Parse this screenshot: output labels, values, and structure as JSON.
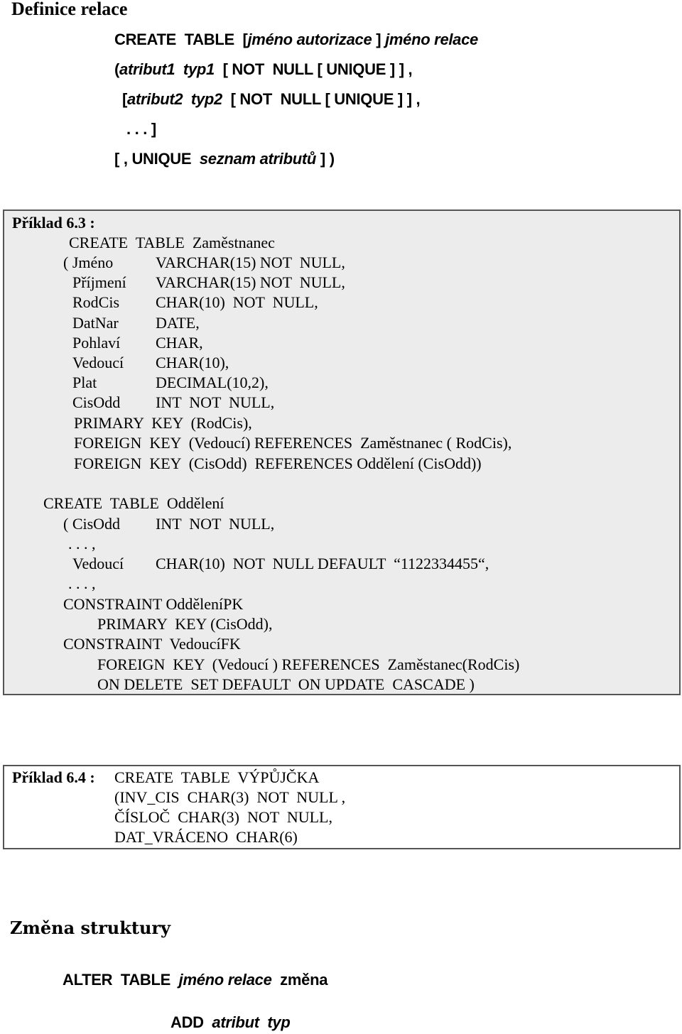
{
  "heading1": "Definice relace",
  "syntax": {
    "l1_kw": "CREATE  TABLE  [",
    "l1_it1": "jméno autorizace",
    "l1_mid": " ] ",
    "l1_it2": "jméno relace",
    "l2_a": "(",
    "l2_it": "atribut1  typ1",
    "l2_b": "  [ NOT  NULL [ UNIQUE ] ] ,",
    "l3_a": "[",
    "l3_it": "atribut2  typ2",
    "l3_b": "  [ NOT  NULL [ UNIQUE ] ] ,",
    "l4": ". . . ]",
    "l5_a": "[ , UNIQUE  ",
    "l5_it": "seznam atributů",
    "l5_b": " ] )"
  },
  "example63": {
    "label": "Příklad 6.3 :",
    "create1": "CREATE  TABLE  Zaměstnanec",
    "cols": [
      [
        "( Jméno",
        "VARCHAR(15) NOT  NULL,"
      ],
      [
        "Příjmení",
        "VARCHAR(15) NOT  NULL,"
      ],
      [
        "RodCis",
        "CHAR(10)  NOT  NULL,"
      ],
      [
        "DatNar",
        "DATE,"
      ],
      [
        "Pohlaví",
        "CHAR,"
      ],
      [
        "Vedoucí",
        "CHAR(10),"
      ],
      [
        "Plat",
        "DECIMAL(10,2),"
      ],
      [
        "CisOdd",
        "INT  NOT  NULL,"
      ]
    ],
    "pk": "PRIMARY  KEY  (RodCis),",
    "fk1": "FOREIGN  KEY  (Vedoucí) REFERENCES  Zaměstnanec ( RodCis),",
    "fk2": "FOREIGN  KEY  (CisOdd)  REFERENCES Oddělení (CisOdd))",
    "create2": "CREATE  TABLE  Oddělení",
    "c2_col1": [
      "( CisOdd",
      "INT  NOT  NULL,"
    ],
    "ellipsis1": ". . . ,",
    "c2_col2": [
      "Vedoucí",
      "CHAR(10)  NOT  NULL DEFAULT  “1122334455“,"
    ],
    "ellipsis2": ". . . ,",
    "con1": "CONSTRAINT OdděleníPK",
    "con1_pk": "PRIMARY  KEY (CisOdd),",
    "con2": "CONSTRAINT  VedoucíFK",
    "con2_fk": "FOREIGN  KEY  (Vedoucí ) REFERENCES  Zaměstanec(RodCis)",
    "con2_on": "ON DELETE  SET DEFAULT  ON UPDATE  CASCADE )"
  },
  "example64": {
    "label": "Příklad 6.4 :",
    "lines": [
      "CREATE  TABLE  VÝPŮJČKA",
      "(INV_CIS  CHAR(3)  NOT  NULL ,",
      "ČÍSLOČ  CHAR(3)  NOT  NULL,",
      "DAT_VRÁCENO  CHAR(6)"
    ]
  },
  "heading2": "Změna struktury",
  "alter": {
    "kw": "ALTER  TABLE  ",
    "it": "jméno relace",
    "tail": "  změna",
    "add_kw": "ADD  ",
    "add_it": "atribut  typ"
  }
}
